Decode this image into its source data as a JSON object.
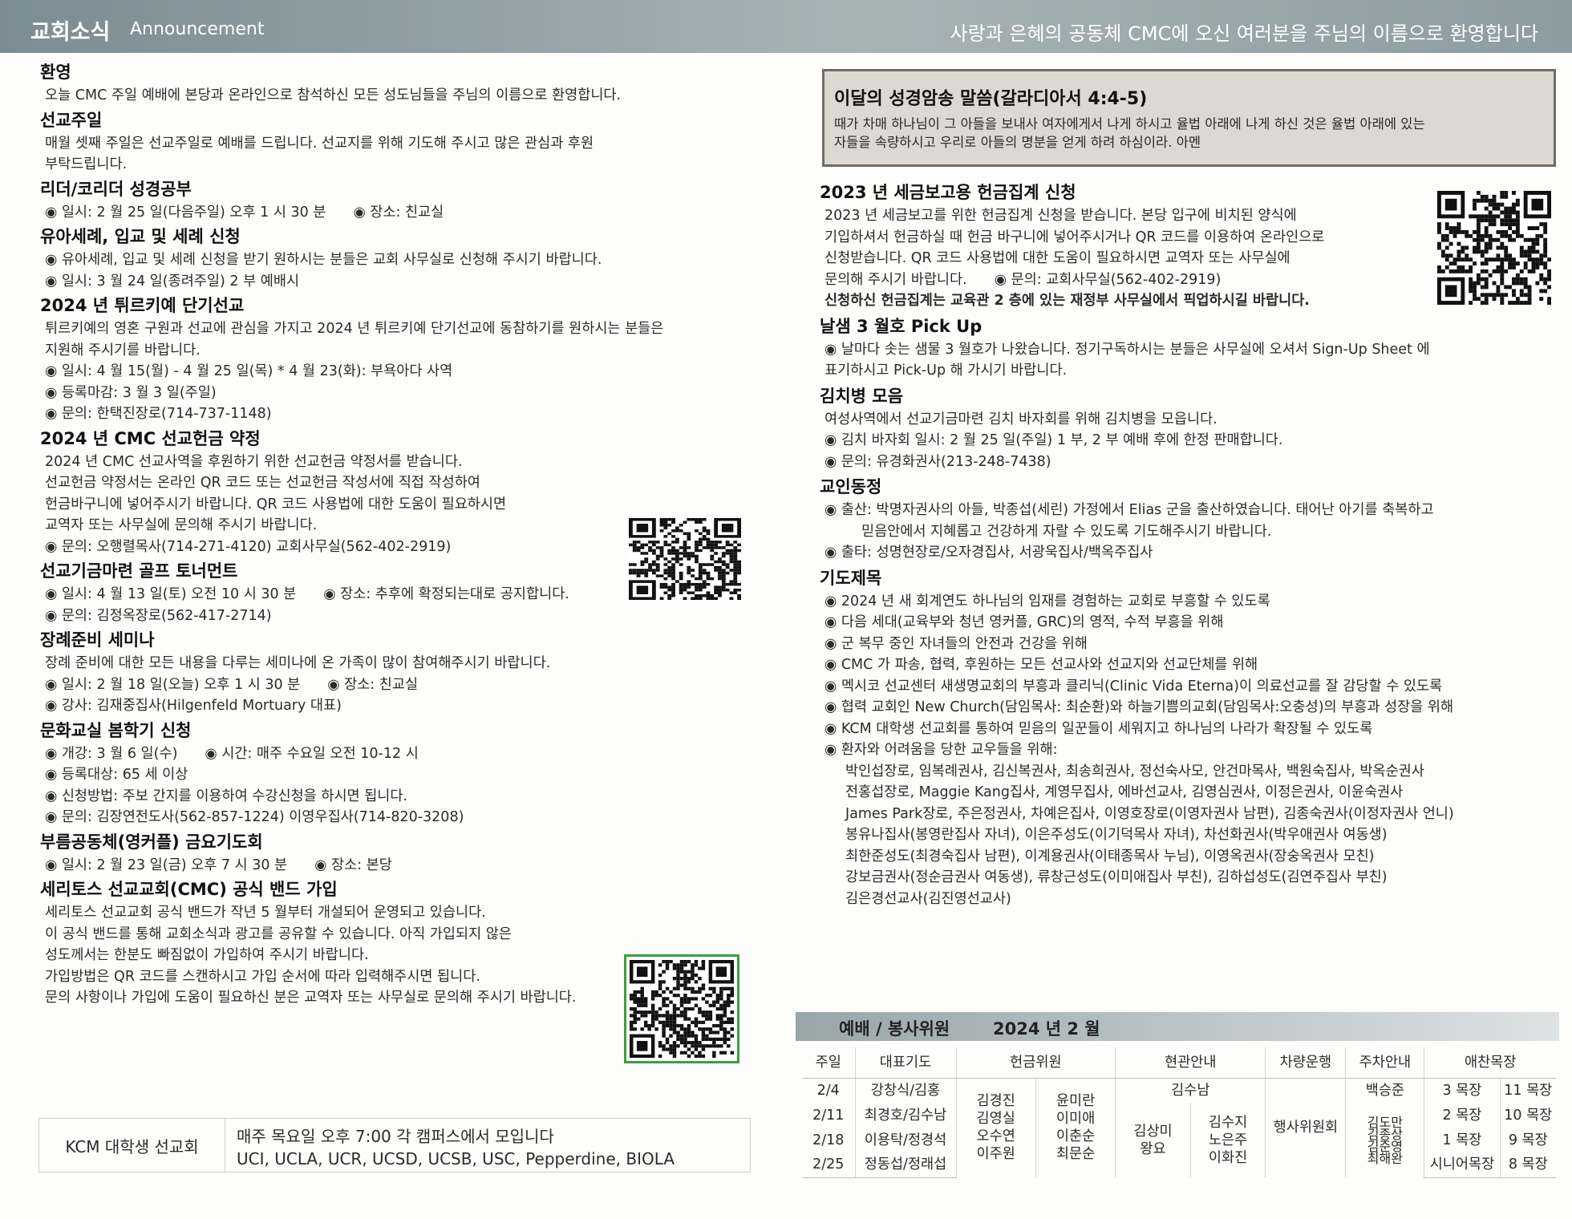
{
  "header": {
    "title": "교회소식",
    "subtitle": "Announcement",
    "welcome": "사랑과 은혜의 공동체 CMC에 오신 여러분을 주님의 이름으로 환영합니다"
  },
  "left": [
    {
      "title": "환영",
      "lines": [
        {
          "t": "오늘 CMC 주일 예배에 본당과 온라인으로 참석하신 모든 성도님들을 주님의 이름으로 환영합니다."
        }
      ]
    },
    {
      "title": "선교주일",
      "lines": [
        {
          "t": "매월 셋째 주일은 선교주일로 예배를 드립니다. 선교지를 위해 기도해 주시고 많은 관심과 후원"
        },
        {
          "t": "부탁드립니다."
        }
      ]
    },
    {
      "title": "리더/코리더 성경공부",
      "lines": [
        {
          "t": "◉ 일시: 2 월 25 일(다음주일) 오후 1 시 30 분",
          "t2": "◉ 장소: 친교실"
        }
      ]
    },
    {
      "title": "유아세례, 입교 및 세례 신청",
      "lines": [
        {
          "t": "◉ 유아세례, 입교 및 세례 신청을 받기 원하시는 분들은 교회 사무실로 신청해 주시기 바랍니다."
        },
        {
          "t": "◉ 일시: 3 월 24 일(종려주일) 2 부 예배시"
        }
      ]
    },
    {
      "title": "2024 년 튀르키예 단기선교",
      "lines": [
        {
          "t": "튀르키예의 영혼 구원과 선교에 관심을 가지고 2024 년 튀르키예 단기선교에 동참하기를 원하시는 분들은"
        },
        {
          "t": "지원해 주시기를 바랍니다."
        },
        {
          "t": "◉ 일시: 4 월 15(월) - 4 월 25 일(목) * 4 월 23(화): 부욕아다 사역"
        },
        {
          "t": "◉ 등록마감: 3 월 3 일(주일)"
        },
        {
          "t": "◉ 문의: 한택진장로(714-737-1148)"
        }
      ]
    },
    {
      "title": "2024 년 CMC 선교헌금 약정",
      "lines": [
        {
          "t": "2024 년 CMC 선교사역을 후원하기 위한 선교헌금 약정서를 받습니다."
        },
        {
          "t": "선교헌금 약정서는 온라인 QR 코드 또는 선교헌금 작성서에 직접 작성하여"
        },
        {
          "t": "헌금바구니에 넣어주시기 바랍니다. QR 코드 사용법에 대한 도움이 필요하시면"
        },
        {
          "t": "교역자 또는 사무실에 문의해 주시기 바랍니다."
        },
        {
          "t": "◉ 문의: 오행렬목사(714-271-4120)  교회사무실(562-402-2919)"
        }
      ]
    },
    {
      "title": "선교기금마련 골프 토너먼트",
      "lines": [
        {
          "t": "◉ 일시: 4 월 13 일(토) 오전 10 시 30 분",
          "t2": "◉ 장소: 추후에 확정되는대로 공지합니다."
        },
        {
          "t": "◉ 문의: 김정옥장로(562-417-2714)"
        }
      ]
    },
    {
      "title": "장례준비 세미나",
      "lines": [
        {
          "t": "장례 준비에 대한 모든 내용을 다루는 세미나에 온 가족이 많이 참여해주시기 바랍니다."
        },
        {
          "t": "◉ 일시: 2 월 18 일(오늘) 오후 1 시 30 분",
          "t2": "◉ 장소: 친교실"
        },
        {
          "t": "◉ 강사: 김재중집사(Hilgenfeld Mortuary 대표)"
        }
      ]
    },
    {
      "title": "문화교실 봄학기 신청",
      "lines": [
        {
          "t": "◉ 개강: 3 월 6 일(수)",
          "t2": "◉ 시간: 매주 수요일 오전 10-12 시"
        },
        {
          "t": "◉ 등록대상: 65 세 이상"
        },
        {
          "t": "◉ 신청방법: 주보 간지를 이용하여 수강신청을 하시면 됩니다."
        },
        {
          "t": "◉ 문의: 김장연전도사(562-857-1224) 이영우집사(714-820-3208)"
        }
      ]
    },
    {
      "title": "부름공동체(영커플) 금요기도회",
      "lines": [
        {
          "t": "◉ 일시: 2 월 23 일(금) 오후 7 시 30 분",
          "t2": "◉ 장소: 본당"
        }
      ]
    },
    {
      "title": "세리토스 선교교회(CMC) 공식 밴드 가입",
      "lines": [
        {
          "t": "세리토스 선교교회 공식 밴드가 작년 5 월부터 개설되어 운영되고 있습니다."
        },
        {
          "t": "이 공식 밴드를 통해 교회소식과 광고를 공유할 수 있습니다. 아직 가입되지 않은"
        },
        {
          "t": "성도께서는 한분도 빠짐없이 가입하여 주시기 바랍니다."
        },
        {
          "t": "가입방법은 QR 코드를 스캔하시고 가입 순서에 따라 입력해주시면 됩니다."
        },
        {
          "t": "문의 사항이나 가입에 도움이 필요하신 분은 교역자 또는 사무실로 문의해 주시기  바랍니다."
        }
      ]
    }
  ],
  "kcm": {
    "name": "KCM 대학생 선교회",
    "line1": "매주 목요일 오후 7:00 각 캠퍼스에서 모입니다",
    "line2": "UCI, UCLA, UCR, UCSD, UCSB, USC, Pepperdine, BIOLA"
  },
  "verse": {
    "title": "이달의 성경암송 말씀(갈라디아서 4:4-5)",
    "line1": "때가 차매 하나님이 그 아들을 보내사 여자에게서 나게 하시고 율법 아래에 나게 하신 것은 율법 아래에 있는",
    "line2": "자들을 속량하시고 우리로 아들의 명분을 얻게 하려 하심이라. 아멘"
  },
  "right": [
    {
      "title": "2023 년 세금보고용 헌금집계 신청",
      "lines": [
        {
          "t": "2023 년 세금보고를 위한 헌금집계 신청을 받습니다. 본당 입구에 비치된 양식에"
        },
        {
          "t": "기입하셔서 헌금하실 때 헌금 바구니에 넣어주시거나 QR 코드를 이용하여 온라인으로"
        },
        {
          "t": "신청받습니다. QR 코드 사용법에 대한 도움이 필요하시면  교역자 또는 사무실에"
        },
        {
          "t": "문의해 주시기 바랍니다.",
          "t2": "◉ 문의: 교회사무실(562-402-2919)"
        },
        {
          "t": "신청하신 헌금집계는 교육관 2 층에 있는 재정부 사무실에서 픽업하시길 바랍니다.",
          "b": true
        }
      ]
    },
    {
      "title": "날샘 3 월호 Pick Up",
      "lines": [
        {
          "t": "◉ 날마다 솟는 샘물 3 월호가 나왔습니다. 정기구독하시는 분들은 사무실에 오셔서 Sign-Up Sheet 에"
        },
        {
          "t": "표기하시고 Pick-Up 해 가시기 바랍니다."
        }
      ]
    },
    {
      "title": "김치병 모음",
      "lines": [
        {
          "t": "여성사역에서 선교기금마련 김치 바자회를 위해 김치병을 모읍니다."
        },
        {
          "t": "◉ 김치 바자회 일시: 2 월 25 일(주일) 1 부, 2 부 예배 후에 한정 판매합니다."
        },
        {
          "t": "◉ 문의: 유경화권사(213-248-7438)"
        }
      ]
    },
    {
      "title": "교인동정",
      "lines": [
        {
          "t": "◉ 출산: 박명자권사의 아들, 박종섭(세린) 가정에서 Elias 군을 출산하였습니다. 태어난 아기를 축복하고"
        },
        {
          "t": "믿음안에서 지혜롭고 건강하게 자랄 수 있도록 기도해주시기 바랍니다.",
          "ind": true
        },
        {
          "t": "◉ 출타: 성명현장로/오자경집사, 서광욱집사/백옥주집사"
        }
      ]
    },
    {
      "title": "기도제목",
      "lines": [
        {
          "t": "◉ 2024 년 새 회계연도 하나님의 임재를 경험하는 교회로 부흥할 수 있도록"
        },
        {
          "t": "◉ 다음 세대(교육부와 청년 영커플, GRC)의 영적, 수적 부흥을 위해"
        },
        {
          "t": "◉ 군 복무 중인 자녀들의 안전과 건강을 위해"
        },
        {
          "t": "◉ CMC 가 파송, 협력, 후원하는 모든 선교사와 선교지와 선교단체를 위해"
        },
        {
          "t": "◉ 멕시코 선교센터 새생명교회의 부흥과 클리닉(Clinic Vida Eterna)이 의료선교를 잘 감당할 수 있도록"
        },
        {
          "t": "◉ 협력 교회인 New Church(담임목사: 최순환)와 하늘기쁨의교회(담임목사:오충성)의 부흥과 성장을 위해"
        },
        {
          "t": "◉ KCM 대학생 선교회를 통하여 믿음의 일꾼들이 세워지고 하나님의 나라가 확장될 수 있도록"
        },
        {
          "t": "◉ 환자와 어려움을 당한 교우들을 위해:"
        },
        {
          "t": "박인섭장로, 임복례권사, 김신복권사, 최송희권사, 정선숙사모, 안건마목사, 백원숙집사, 박옥순권사",
          "p": true
        },
        {
          "t": "전홍섭장로, Maggie Kang집사, 계영무집사, 에바선교사, 김영심권사, 이정은권사, 이윤숙권사",
          "p": true
        },
        {
          "t": "James Park장로, 주은정권사, 차예은집사, 이영호장로(이영자권사 남편), 김종숙권사(이정자권사 언니)",
          "p": true
        },
        {
          "t": "봉유나집사(봉영란집사 자녀), 이은주성도(이기덕목사 자녀), 차선화권사(박우애권사 여동생)",
          "p": true
        },
        {
          "t": "최한준성도(최경숙집사 남편), 이계용권사(이태종목사 누님), 이영옥권사(장숭옥권사 모친)",
          "p": true
        },
        {
          "t": "강보금권사(정순금권사 여동생), 류창근성도(이미애집사 부친), 김하섭성도(김연주집사 부친)",
          "p": true
        },
        {
          "t": "김은경선교사(김진영선교사)",
          "p": true
        }
      ]
    }
  ],
  "service": {
    "label": "예배 / 봉사위원",
    "month": "2024 년 2 월",
    "headers": [
      "주일",
      "대표기도",
      "헌금위원",
      "현관안내",
      "차량운행",
      "주차안내",
      "애찬목장"
    ],
    "dates": [
      "2/4",
      "2/11",
      "2/18",
      "2/25"
    ],
    "prayer": [
      "강창식/김홍",
      "최경호/김수남",
      "이용탁/정경석",
      "정동섭/정래섭"
    ],
    "offering_a": [
      "김경진",
      "김영실",
      "오수연",
      "이주원"
    ],
    "offering_b": [
      "윤미란",
      "이미애",
      "이춘순",
      "최문순"
    ],
    "usher_top": "김수남",
    "usher_a": [
      "김상미",
      "왕요"
    ],
    "usher_b": [
      "김수지",
      "노은주",
      "이화진"
    ],
    "vehicle": "행사위원회",
    "parking": [
      "백승준",
      "김도만",
      "김종상",
      "김준영",
      "최해완"
    ],
    "meal_a": [
      "3 목장",
      "2 목장",
      "1 목장",
      "시니어목장"
    ],
    "meal_b": [
      "11 목장",
      "10 목장",
      "9 목장",
      "8 목장"
    ]
  }
}
